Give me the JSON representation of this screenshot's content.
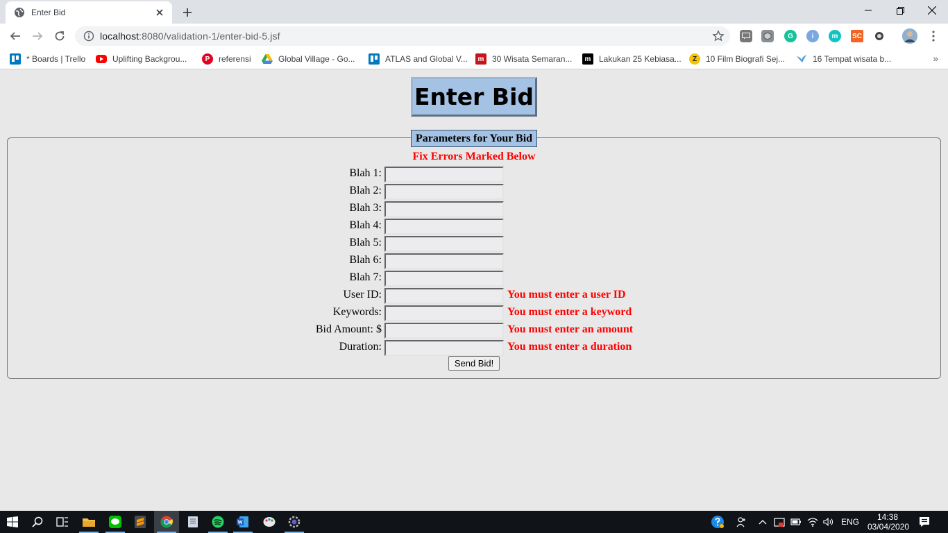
{
  "browser": {
    "tab_title": "Enter Bid",
    "url_host": "localhost",
    "url_rest": ":8080/validation-1/enter-bid-5.jsf",
    "bookmarks": [
      {
        "label": "* Boards | Trello",
        "icon": "trello-icon",
        "color": "#0079bf"
      },
      {
        "label": "Uplifting Backgrou...",
        "icon": "youtube-icon",
        "color": "#ff0000"
      },
      {
        "label": "referensi",
        "icon": "pinterest-icon",
        "color": "#e60023"
      },
      {
        "label": "Global Village - Go...",
        "icon": "google-drive-icon",
        "color": "#34a853"
      },
      {
        "label": "ATLAS and Global V...",
        "icon": "trello-icon",
        "color": "#0079bf"
      },
      {
        "label": "30 Wisata Semaran...",
        "icon": "m-logo-icon",
        "color": "#c4161c"
      },
      {
        "label": "Lakukan 25 Kebiasa...",
        "icon": "m-logo-icon",
        "color": "#000000"
      },
      {
        "label": "10 Film Biografi Sej...",
        "icon": "z-logo-icon",
        "color": "#f5c400"
      },
      {
        "label": "16 Tempat wisata b...",
        "icon": "bird-icon",
        "color": "#4a9fe0"
      }
    ],
    "bookmarks_more": "»"
  },
  "page": {
    "title": "Enter Bid",
    "legend": "Parameters for Your Bid",
    "error_heading": "Fix Errors Marked Below",
    "fields": [
      {
        "label": "Blah 1:",
        "value": "",
        "error": ""
      },
      {
        "label": "Blah 2:",
        "value": "",
        "error": ""
      },
      {
        "label": "Blah 3:",
        "value": "",
        "error": ""
      },
      {
        "label": "Blah 4:",
        "value": "",
        "error": ""
      },
      {
        "label": "Blah 5:",
        "value": "",
        "error": ""
      },
      {
        "label": "Blah 6:",
        "value": "",
        "error": ""
      },
      {
        "label": "Blah 7:",
        "value": "",
        "error": ""
      },
      {
        "label": "User ID:",
        "value": "",
        "error": "You must enter a user ID"
      },
      {
        "label": "Keywords:",
        "value": "",
        "error": "You must enter a keyword"
      },
      {
        "label": "Bid Amount: $",
        "value": "",
        "error": "You must enter an amount"
      },
      {
        "label": "Duration:",
        "value": "",
        "error": "You must enter a duration"
      }
    ],
    "submit_label": "Send Bid!",
    "colors": {
      "title_bg": "#a4c2e3",
      "error": "#ff0000",
      "page_bg": "#e8e8e8"
    }
  },
  "taskbar": {
    "apps": [
      "start-icon",
      "search-icon",
      "task-view-icon",
      "file-explorer-icon",
      "line-icon",
      "sublime-text-icon",
      "chrome-icon",
      "notes-icon",
      "spotify-icon",
      "word-icon",
      "paint-icon",
      "settings-app-icon"
    ],
    "language": "ENG",
    "time": "14:38",
    "date": "03/04/2020"
  }
}
